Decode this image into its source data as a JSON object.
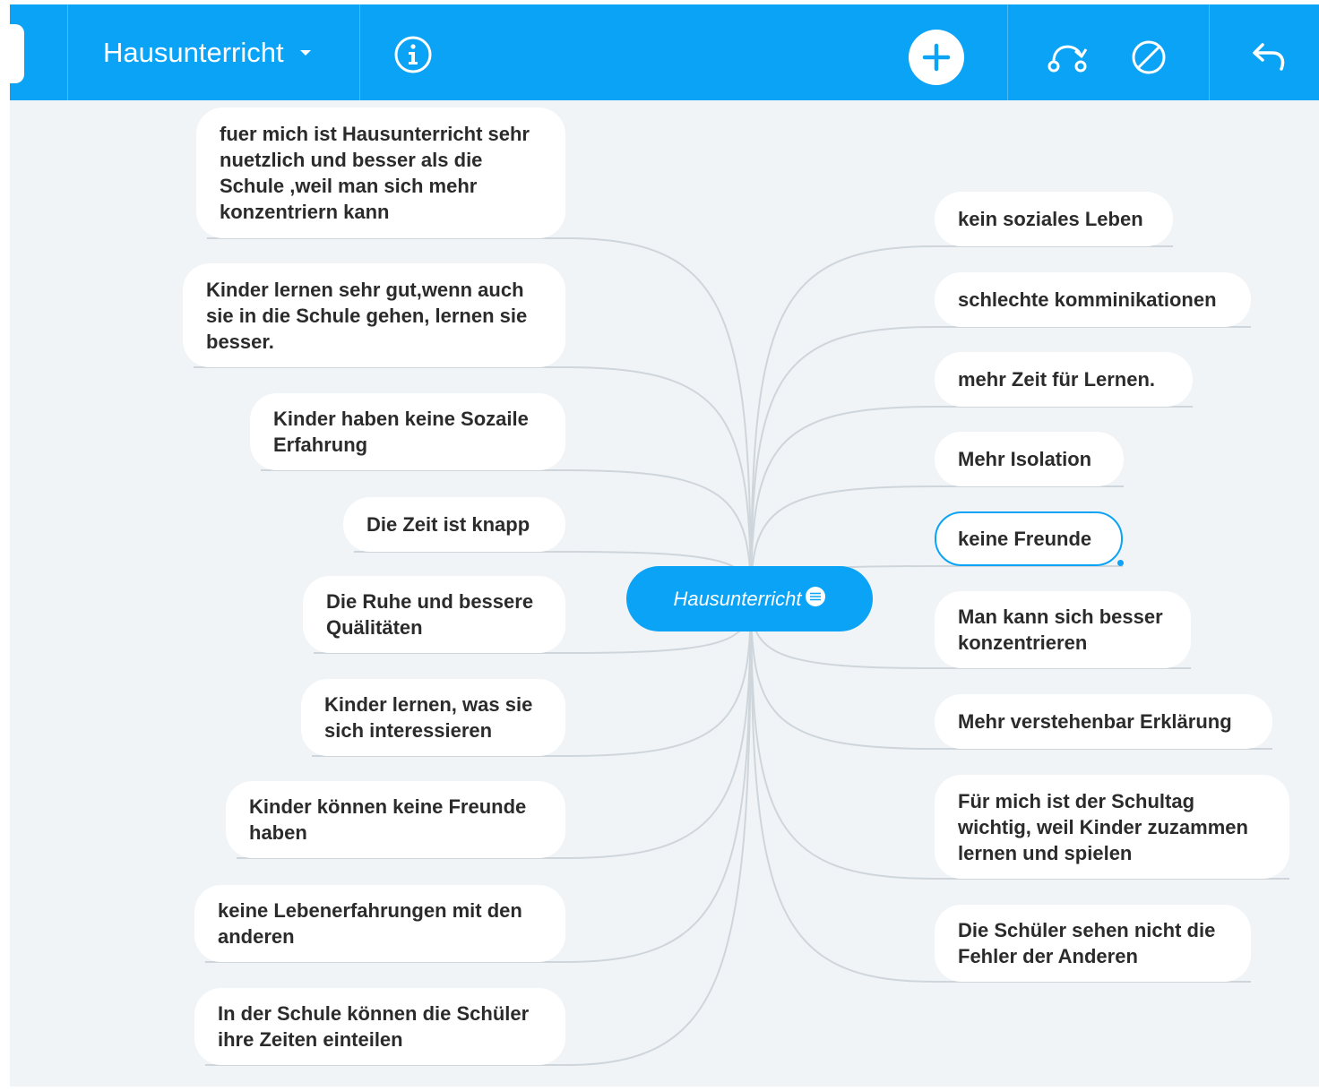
{
  "toolbar": {
    "map_title": "Hausunterricht",
    "icons": [
      "info-icon",
      "add-icon",
      "connect-icon",
      "no-style-icon",
      "undo-icon"
    ],
    "accent_color": "#0aa3f5"
  },
  "mindmap": {
    "central": {
      "label": "Hausunterricht",
      "icon": "note-icon"
    },
    "left_nodes": [
      {
        "text": "fuer mich ist Hausunterricht sehr nuetzlich und besser als die Schule ,weil man sich mehr konzentriern kann"
      },
      {
        "text": "Kinder lernen sehr gut,wenn auch sie in die Schule gehen, lernen sie besser."
      },
      {
        "text": "Kinder haben keine Sozaile Erfahrung"
      },
      {
        "text": "Die Zeit ist knapp"
      },
      {
        "text": "Die Ruhe und bessere Quälitäten"
      },
      {
        "text": "Kinder lernen, was sie sich interessieren"
      },
      {
        "text": "Kinder können keine Freunde haben"
      },
      {
        "text": "keine Lebenerfahrungen mit den anderen"
      },
      {
        "text": "In der Schule können die Schüler ihre Zeiten einteilen"
      }
    ],
    "right_nodes": [
      {
        "text": "kein soziales Leben"
      },
      {
        "text": "schlechte komminikationen"
      },
      {
        "text": "mehr Zeit für Lernen."
      },
      {
        "text": "Mehr Isolation"
      },
      {
        "text": "keine Freunde",
        "selected": true
      },
      {
        "text": "Man kann sich besser konzentrieren"
      },
      {
        "text": "Mehr verstehenbar Erklärung"
      },
      {
        "text": "Für mich ist der Schultag wichtig, weil Kinder zuzammen lernen und spielen"
      },
      {
        "text": "Die Schüler sehen nicht die Fehler der Anderen"
      }
    ]
  }
}
